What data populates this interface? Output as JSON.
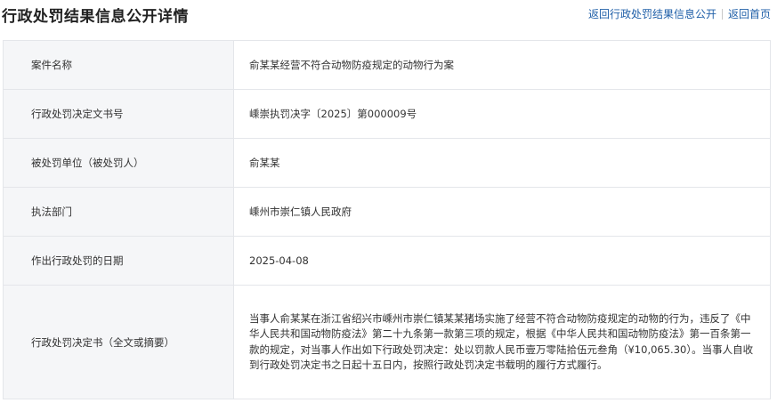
{
  "header": {
    "title": "行政处罚结果信息公开详情",
    "link_back_list": "返回行政处罚结果信息公开",
    "link_home": "返回首页"
  },
  "rows": [
    {
      "label": "案件名称",
      "value": "俞某某经营不符合动物防疫规定的动物行为案"
    },
    {
      "label": "行政处罚决定文书号",
      "value": "嵊崇执罚决字〔2025〕第000009号"
    },
    {
      "label": "被处罚单位（被处罚人）",
      "value": "俞某某"
    },
    {
      "label": "执法部门",
      "value": "嵊州市崇仁镇人民政府"
    },
    {
      "label": "作出行政处罚的日期",
      "value": "2025-04-08"
    },
    {
      "label": "行政处罚决定书（全文或摘要）",
      "value": "当事人俞某某在浙江省绍兴市嵊州市崇仁镇某某猪场实施了经营不符合动物防疫规定的动物的行为，违反了《中华人民共和国动物防疫法》第二十九条第一款第三项的规定，根据《中华人民共和国动物防疫法》第一百条第一款的规定，对当事人作出如下行政处罚决定：处以罚款人民币壹万零陆拾伍元叁角（¥10,065.30）。当事人自收到行政处罚决定书之日起十五日内，按照行政处罚决定书载明的履行方式履行。"
    }
  ],
  "colors": {
    "link": "#1f5fa8",
    "label_bg": "#f5f6f8",
    "border": "#e4e6ea"
  }
}
